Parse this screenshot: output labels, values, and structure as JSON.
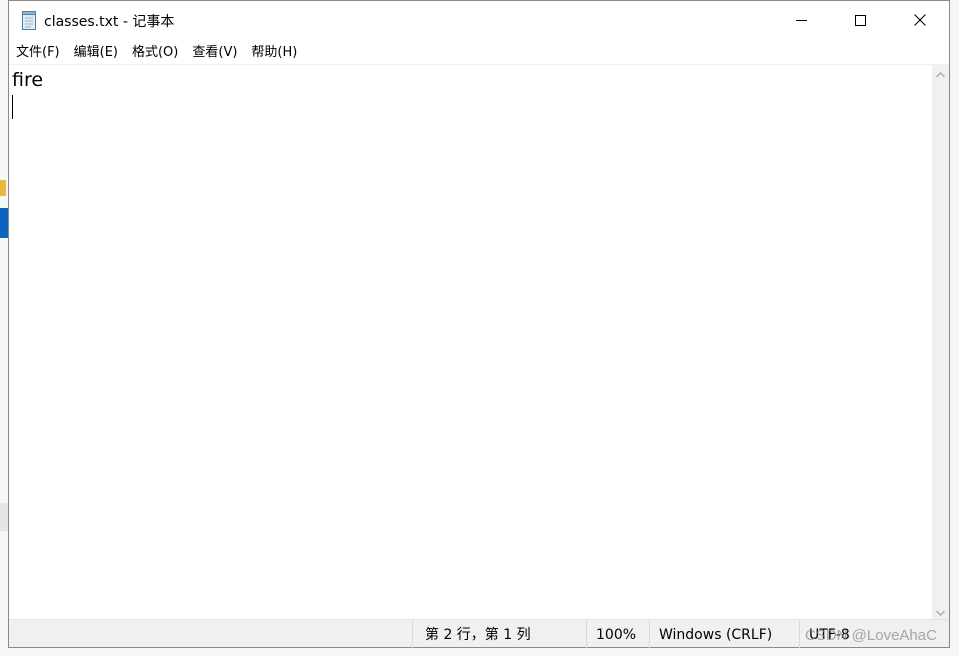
{
  "window": {
    "title": "classes.txt - 记事本",
    "icon": "notepad-icon"
  },
  "caption_buttons": {
    "minimize": "minimize-icon",
    "maximize": "maximize-icon",
    "close": "close-icon"
  },
  "menu": {
    "items": [
      {
        "label": "文件(F)"
      },
      {
        "label": "编辑(E)"
      },
      {
        "label": "格式(O)"
      },
      {
        "label": "查看(V)"
      },
      {
        "label": "帮助(H)"
      }
    ]
  },
  "editor": {
    "lines": [
      "fire",
      ""
    ]
  },
  "statusbar": {
    "position": "第 2 行，第 1 列",
    "zoom": "100%",
    "line_ending": "Windows (CRLF)",
    "encoding": "UTF-8"
  },
  "watermark": "CSDN @LoveAhaC",
  "colors": {
    "accent": "#0b64c0",
    "statusbar_bg": "#f0f0f0"
  }
}
